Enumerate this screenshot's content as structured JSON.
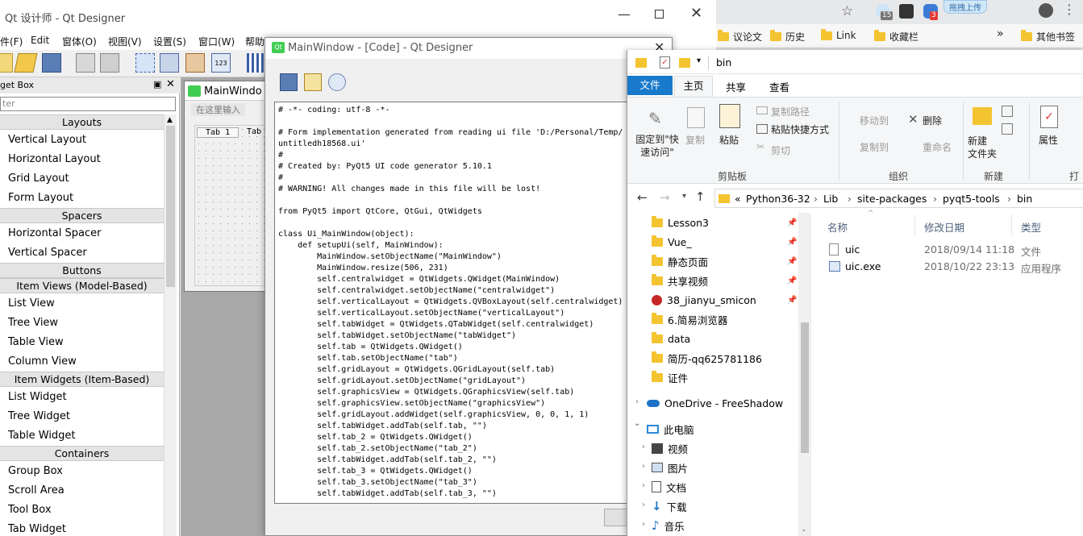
{
  "browser": {
    "bookmarks": [
      "议论文",
      "历史",
      "Link",
      "收藏栏",
      "其他书签"
    ],
    "more": "»",
    "badge_15": "15",
    "badge_3": "3",
    "upload_label": "拖拽上传",
    "star_icon": "star-icon",
    "profile_icon": "profile-icon"
  },
  "qt": {
    "title": "Qt 设计师 - Qt Designer",
    "menus": [
      "件(F)",
      "Edit",
      "窗体(O)",
      "视图(V)",
      "设置(S)",
      "窗口(W)",
      "帮助"
    ],
    "widget_box": {
      "title": "get Box",
      "filter_placeholder": "ter",
      "categories": {
        "layouts": "Layouts",
        "spacers": "Spacers",
        "buttons": "Buttons",
        "item_views": "Item Views (Model-Based)",
        "item_widgets": "Item Widgets (Item-Based)",
        "containers": "Containers"
      },
      "layouts": [
        "Vertical Layout",
        "Horizontal Layout",
        "Grid Layout",
        "Form Layout"
      ],
      "spacers": [
        "Horizontal Spacer",
        "Vertical Spacer"
      ],
      "item_views": [
        "List View",
        "Tree View",
        "Table View",
        "Column View"
      ],
      "item_widgets": [
        "List Widget",
        "Tree Widget",
        "Table Widget"
      ],
      "containers": [
        "Group Box",
        "Scroll Area",
        "Tool Box",
        "Tab Widget"
      ]
    },
    "form": {
      "title": "MainWindo",
      "menu_placeholder": "在这里输入",
      "tab1": "Tab 1",
      "tab2": "Tab"
    }
  },
  "code_dialog": {
    "title": "MainWindow - [Code] - Qt Designer",
    "close_button": "C",
    "lines": [
      "# -*- coding: utf-8 -*-",
      "",
      "# Form implementation generated from reading ui file 'D:/Personal/Temp/",
      "untitledh18568.ui'",
      "#",
      "# Created by: PyQt5 UI code generator 5.10.1",
      "#",
      "# WARNING! All changes made in this file will be lost!",
      "",
      "from PyQt5 import QtCore, QtGui, QtWidgets",
      "",
      "class Ui_MainWindow(object):",
      "    def setupUi(self, MainWindow):",
      "        MainWindow.setObjectName(\"MainWindow\")",
      "        MainWindow.resize(506, 231)",
      "        self.centralwidget = QtWidgets.QWidget(MainWindow)",
      "        self.centralwidget.setObjectName(\"centralwidget\")",
      "        self.verticalLayout = QtWidgets.QVBoxLayout(self.centralwidget)",
      "        self.verticalLayout.setObjectName(\"verticalLayout\")",
      "        self.tabWidget = QtWidgets.QTabWidget(self.centralwidget)",
      "        self.tabWidget.setObjectName(\"tabWidget\")",
      "        self.tab = QtWidgets.QWidget()",
      "        self.tab.setObjectName(\"tab\")",
      "        self.gridLayout = QtWidgets.QGridLayout(self.tab)",
      "        self.gridLayout.setObjectName(\"gridLayout\")",
      "        self.graphicsView = QtWidgets.QGraphicsView(self.tab)",
      "        self.graphicsView.setObjectName(\"graphicsView\")",
      "        self.gridLayout.addWidget(self.graphicsView, 0, 0, 1, 1)",
      "        self.tabWidget.addTab(self.tab, \"\")",
      "        self.tab_2 = QtWidgets.QWidget()",
      "        self.tab_2.setObjectName(\"tab_2\")",
      "        self.tabWidget.addTab(self.tab_2, \"\")",
      "        self.tab_3 = QtWidgets.QWidget()",
      "        self.tab_3.setObjectName(\"tab_3\")",
      "        self.tabWidget.addTab(self.tab_3, \"\")"
    ]
  },
  "explorer": {
    "title": "bin",
    "tabs": [
      "文件",
      "主页",
      "共享",
      "查看"
    ],
    "ribbon": {
      "pin": "固定到\"快速访问\"",
      "copy": "复制",
      "paste": "粘贴",
      "copy_path": "复制路径",
      "paste_shortcut": "粘贴快捷方式",
      "cut": "剪切",
      "move_to": "移动到",
      "copy_to": "复制到",
      "delete": "删除",
      "rename": "重命名",
      "new_folder": "新建\n文件夹",
      "properties": "属性",
      "group_clipboard": "剪贴板",
      "group_organize": "组织",
      "group_new": "新建",
      "group_open": "打开"
    },
    "breadcrumb": [
      "«",
      "Python36-32",
      "Lib",
      "site-packages",
      "pyqt5-tools",
      "bin"
    ],
    "nav": {
      "quick": [
        "Lesson3",
        "Vue_",
        "静态页面",
        "共享视频",
        "38_jianyu_smicon",
        "6.简易浏览器",
        "data",
        "简历-qq625781186",
        "证件"
      ],
      "onedrive": "OneDrive - FreeShadow",
      "this_pc": "此电脑",
      "pc_items": [
        "视频",
        "图片",
        "文档",
        "下载",
        "音乐"
      ]
    },
    "columns": [
      "名称",
      "修改日期",
      "类型"
    ],
    "files": [
      {
        "name": "uic",
        "date": "2018/09/14 11:18",
        "type": "文件"
      },
      {
        "name": "uic.exe",
        "date": "2018/10/22 23:13",
        "type": "应用程序"
      }
    ]
  }
}
